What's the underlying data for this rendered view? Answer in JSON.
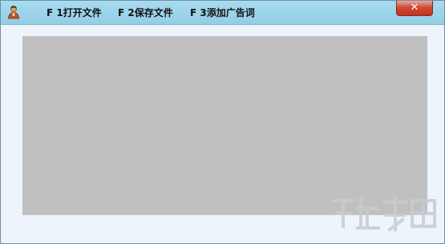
{
  "menu": {
    "open_file": "F 1打开文件",
    "save_file": "F 2保存文件",
    "add_ad_word": "F 3添加广告词"
  },
  "window": {
    "close_glyph": "✕"
  },
  "icons": {
    "app": "user-figure-icon",
    "close": "close-icon"
  },
  "colors": {
    "titlebar": "#9fd6ec",
    "client_bg": "#eef4fb",
    "panel_bg": "#c0c0c0",
    "close_red": "#c9402c"
  }
}
